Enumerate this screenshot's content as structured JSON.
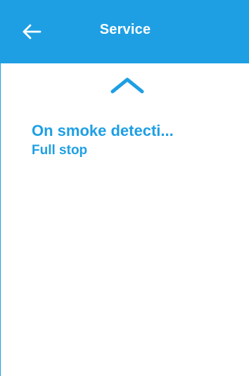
{
  "header": {
    "title": "Service",
    "back_icon": "back-arrow-icon",
    "color": "#1e9fe4"
  },
  "nav": {
    "up_icon": "chevron-up-icon"
  },
  "setting": {
    "name": "On smoke detecti...",
    "value": "Full stop"
  },
  "colors": {
    "accent": "#1e9fe4",
    "background": "#ffffff"
  }
}
